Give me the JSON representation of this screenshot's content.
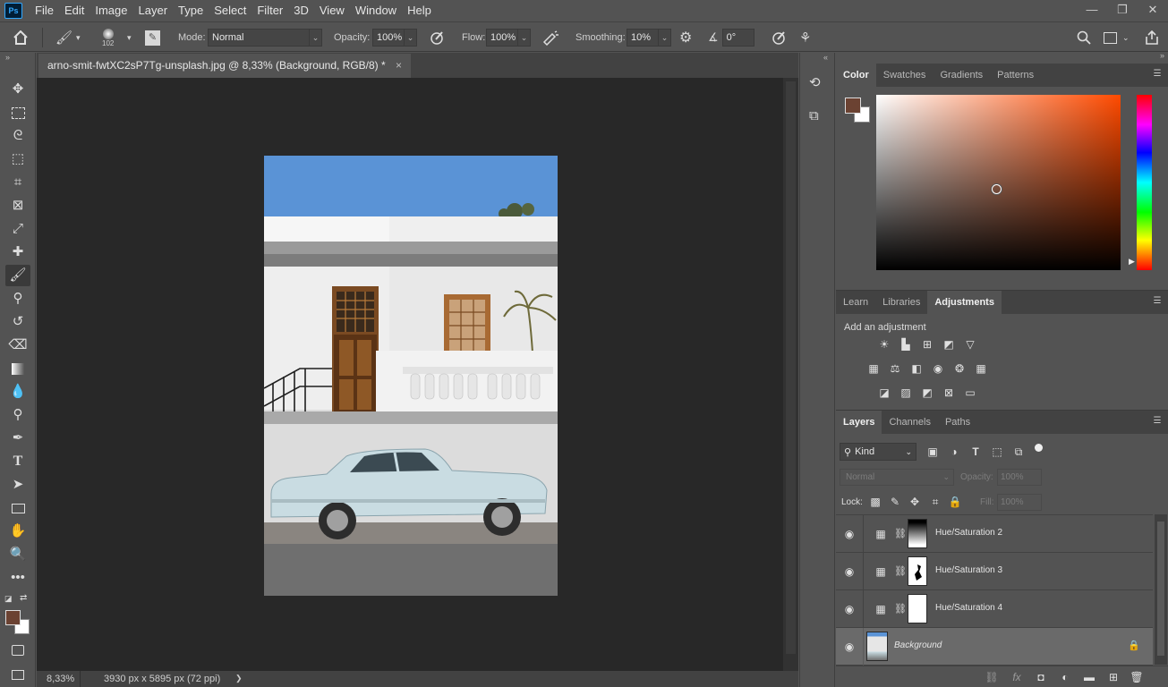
{
  "menubar": {
    "logo": "Ps",
    "items": [
      "File",
      "Edit",
      "Image",
      "Layer",
      "Type",
      "Select",
      "Filter",
      "3D",
      "View",
      "Window",
      "Help"
    ],
    "controls": {
      "minimize": "—",
      "restore": "❐",
      "close": "✕"
    }
  },
  "options": {
    "brush_size": "102",
    "mode_label": "Mode:",
    "mode_value": "Normal",
    "opacity_label": "Opacity:",
    "opacity_value": "100%",
    "flow_label": "Flow:",
    "flow_value": "100%",
    "smoothing_label": "Smoothing:",
    "smoothing_value": "10%",
    "angle_value": "0°"
  },
  "document": {
    "tab_title": "arno-smit-fwtXC2sP7Tg-unsplash.jpg @ 8,33% (Background, RGB/8) *",
    "close_glyph": "×",
    "zoom": "8,33%",
    "info": "3930 px x 5895 px (72 ppi)",
    "info_arrow": "❯"
  },
  "color_panel": {
    "tabs": [
      "Color",
      "Swatches",
      "Gradients",
      "Patterns"
    ],
    "active_tab": "Color",
    "foreground": "#6b4232",
    "background": "#ffffff",
    "hue": "#ff4a00"
  },
  "adjustments_panel": {
    "tabs": [
      "Learn",
      "Libraries",
      "Adjustments"
    ],
    "active_tab": "Adjustments",
    "heading": "Add an adjustment"
  },
  "layers_panel": {
    "tabs": [
      "Layers",
      "Channels",
      "Paths"
    ],
    "active_tab": "Layers",
    "filter_kind": "Kind",
    "blend_mode": "Normal",
    "opacity_label": "Opacity:",
    "opacity_value": "100%",
    "lock_label": "Lock:",
    "fill_label": "Fill:",
    "fill_value": "100%",
    "layers": [
      {
        "name": "Hue/Saturation 2",
        "type": "adjustment"
      },
      {
        "name": "Hue/Saturation 3",
        "type": "adjustment"
      },
      {
        "name": "Hue/Saturation 4",
        "type": "adjustment"
      },
      {
        "name": "Background",
        "type": "image",
        "locked": true,
        "selected": true
      }
    ]
  }
}
